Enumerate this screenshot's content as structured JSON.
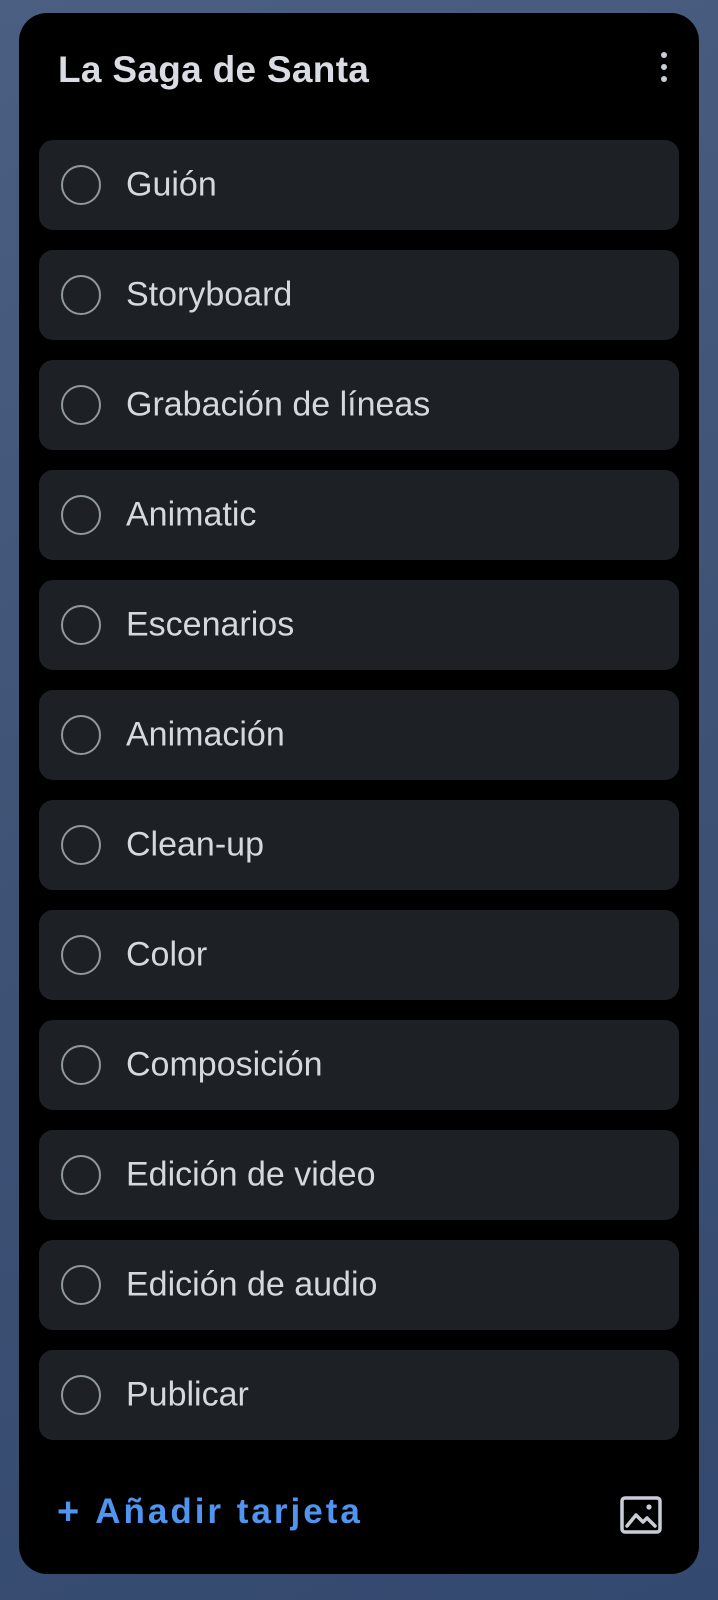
{
  "list": {
    "title": "La Saga de Santa",
    "menu_icon": "more-vertical-icon"
  },
  "cards": [
    {
      "label": "Guión",
      "completed": false
    },
    {
      "label": "Storyboard",
      "completed": false
    },
    {
      "label": "Grabación de líneas",
      "completed": false
    },
    {
      "label": "Animatic",
      "completed": false
    },
    {
      "label": "Escenarios",
      "completed": false
    },
    {
      "label": "Animación",
      "completed": false
    },
    {
      "label": "Clean-up",
      "completed": false
    },
    {
      "label": "Color",
      "completed": false
    },
    {
      "label": "Composición",
      "completed": false
    },
    {
      "label": "Edición de video",
      "completed": false
    },
    {
      "label": "Edición de audio",
      "completed": false
    },
    {
      "label": "Publicar",
      "completed": false
    }
  ],
  "footer": {
    "add_icon": "plus",
    "add_symbol": "+",
    "add_label": "Añadir tarjeta",
    "template_icon": "image-icon"
  },
  "colors": {
    "accent": "#4f94f0",
    "panel_bg": "#000000",
    "card_bg": "#1d2125",
    "card_text": "#d5d9de",
    "circle_stroke": "#8f979f"
  }
}
